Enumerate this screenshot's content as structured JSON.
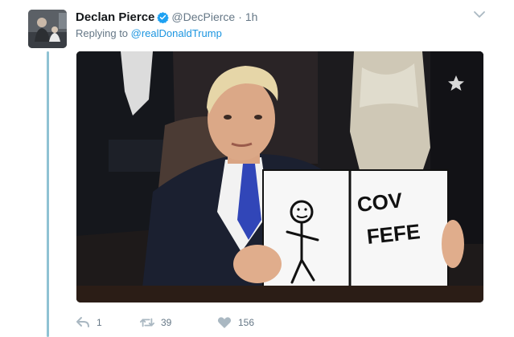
{
  "tweet": {
    "author": {
      "name": "Declan Pierce",
      "handle": "@DecPierce",
      "verified": true
    },
    "separator": "·",
    "time": "1h",
    "reply_prefix": "Replying to ",
    "reply_to": "@realDonaldTrump",
    "media": {
      "sign_left_icon": "stick-figure-drawing",
      "sign_text_line1": "COV",
      "sign_text_line2": "FEFE"
    },
    "actions": {
      "reply_count": "1",
      "retweet_count": "39",
      "like_count": "156"
    }
  },
  "colors": {
    "text_primary": "#14171a",
    "text_secondary": "#657786",
    "link": "#1b95e0",
    "verified_badge": "#1da1f2",
    "thread_line": "#8fc2d3",
    "action_icon": "#aab8c2"
  }
}
